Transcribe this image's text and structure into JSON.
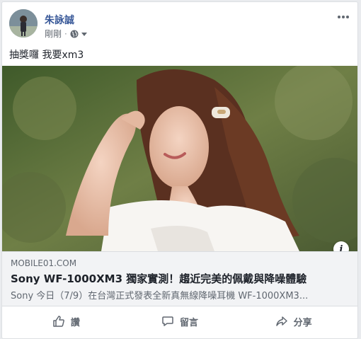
{
  "post": {
    "author": "朱詠誠",
    "timestamp": "剛剛",
    "privacy_icon": "globe-icon",
    "message": "抽獎囉 我要xm3"
  },
  "link": {
    "domain": "MOBILE01.COM",
    "title": "Sony WF-1000XM3 獨家實測！趨近完美的佩戴與降噪體驗",
    "description": "Sony 今日（7/9）在台灣正式發表全新真無線降噪耳機 WF-1000XM3...",
    "info_label": "i"
  },
  "actions": {
    "like": "讚",
    "comment": "留言",
    "share": "分享"
  },
  "colors": {
    "author": "#385898",
    "secondary_text": "#606770",
    "link_background": "#f2f3f5"
  }
}
